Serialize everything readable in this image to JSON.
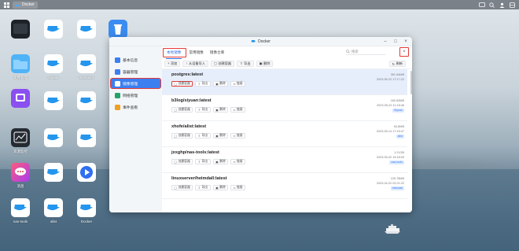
{
  "topbar": {
    "app_tab_label": "Docker",
    "icons": [
      "grid-icon",
      "docker-icon",
      "chat-icon",
      "search-icon",
      "user-icon",
      "widget-icon"
    ]
  },
  "desktop": {
    "labels": [
      "文件管理",
      "siyuan",
      "instructor",
      "",
      "",
      "",
      "资源监控",
      "",
      "",
      "消息",
      "",
      "",
      "nas-tools",
      "alist",
      "Docker"
    ]
  },
  "window": {
    "title": "Docker",
    "sidebar": [
      {
        "label": "基本信息",
        "icon": "info-icon",
        "color": "#3b7ff0"
      },
      {
        "label": "容器管理",
        "icon": "container-icon",
        "color": "#3b7ff0"
      },
      {
        "label": "镜像管理",
        "icon": "image-icon",
        "color": "#ffffff"
      },
      {
        "label": "网络管理",
        "icon": "network-icon",
        "color": "#26a269"
      },
      {
        "label": "事件查看",
        "icon": "event-icon",
        "color": "#f0a020"
      }
    ],
    "tabs": [
      "本地镜像",
      "常用镜像",
      "镜像仓库"
    ],
    "search_placeholder": "搜索",
    "toolbar": {
      "add": "添加",
      "import": "从设备导入",
      "create_container": "创建容器",
      "export": "导出",
      "delete": "删除",
      "refresh": "刷新"
    },
    "images": [
      {
        "name": "postgres:latest",
        "size": "391.54MB",
        "date": "2023-05-22 17:17:22",
        "badge": ""
      },
      {
        "name": "b3log/siyuan:latest",
        "size": "180.60MB",
        "date": "2023-05-22 11:18:46",
        "badge": "Siyuan"
      },
      {
        "name": "xhofe/alist:latest",
        "size": "54.8MB",
        "date": "2023-05-14 17:15:47",
        "badge": "alist"
      },
      {
        "name": "jxxghp/nas-tools:latest",
        "size": "1.21GB",
        "date": "2023-05-02 15:18:09",
        "badge": "nas-tools"
      },
      {
        "name": "linuxserver/heimdall:latest",
        "size": "125.78MB",
        "date": "2023-04-22 02:21:22",
        "badge": "heimdall"
      }
    ],
    "row_actions": {
      "create_container": "创建容器",
      "export": "导出",
      "delete": "删除",
      "link": "链接"
    }
  },
  "colors": {
    "accent": "#3b7ff0",
    "highlight": "#e53935"
  }
}
